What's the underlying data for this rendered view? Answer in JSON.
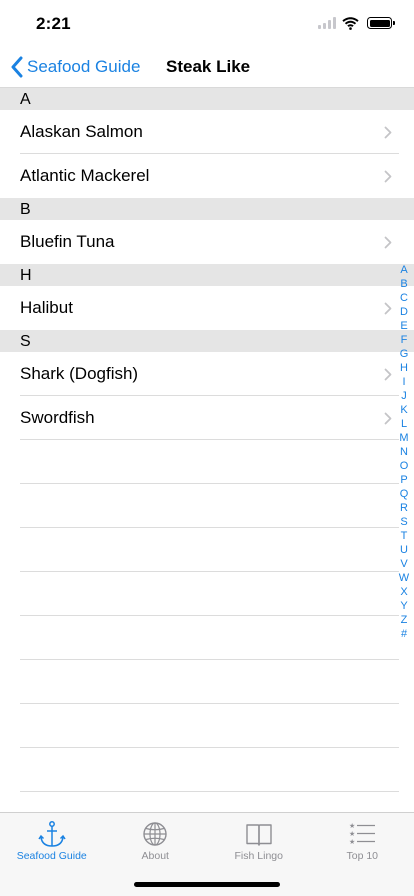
{
  "status": {
    "time": "2:21"
  },
  "nav": {
    "back_label": "Seafood Guide",
    "title": "Steak Like"
  },
  "sections": [
    {
      "header": "A",
      "rows": [
        "Alaskan Salmon",
        "Atlantic Mackerel"
      ]
    },
    {
      "header": "B",
      "rows": [
        "Bluefin Tuna"
      ]
    },
    {
      "header": "H",
      "rows": [
        "Halibut"
      ]
    },
    {
      "header": "S",
      "rows": [
        "Shark (Dogfish)",
        "Swordfish"
      ]
    }
  ],
  "index": [
    "A",
    "B",
    "C",
    "D",
    "E",
    "F",
    "G",
    "H",
    "I",
    "J",
    "K",
    "L",
    "M",
    "N",
    "O",
    "P",
    "Q",
    "R",
    "S",
    "T",
    "U",
    "V",
    "W",
    "X",
    "Y",
    "Z",
    "#"
  ],
  "tabs": [
    {
      "label": "Seafood Guide",
      "icon": "anchor-icon",
      "active": true
    },
    {
      "label": "About",
      "icon": "globe-icon",
      "active": false
    },
    {
      "label": "Fish Lingo",
      "icon": "book-icon",
      "active": false
    },
    {
      "label": "Top 10",
      "icon": "ranked-list-icon",
      "active": false
    }
  ],
  "colors": {
    "accent": "#1a82e2",
    "section_header": "#e5e5e5",
    "inactive_tab": "#8e8e93"
  }
}
